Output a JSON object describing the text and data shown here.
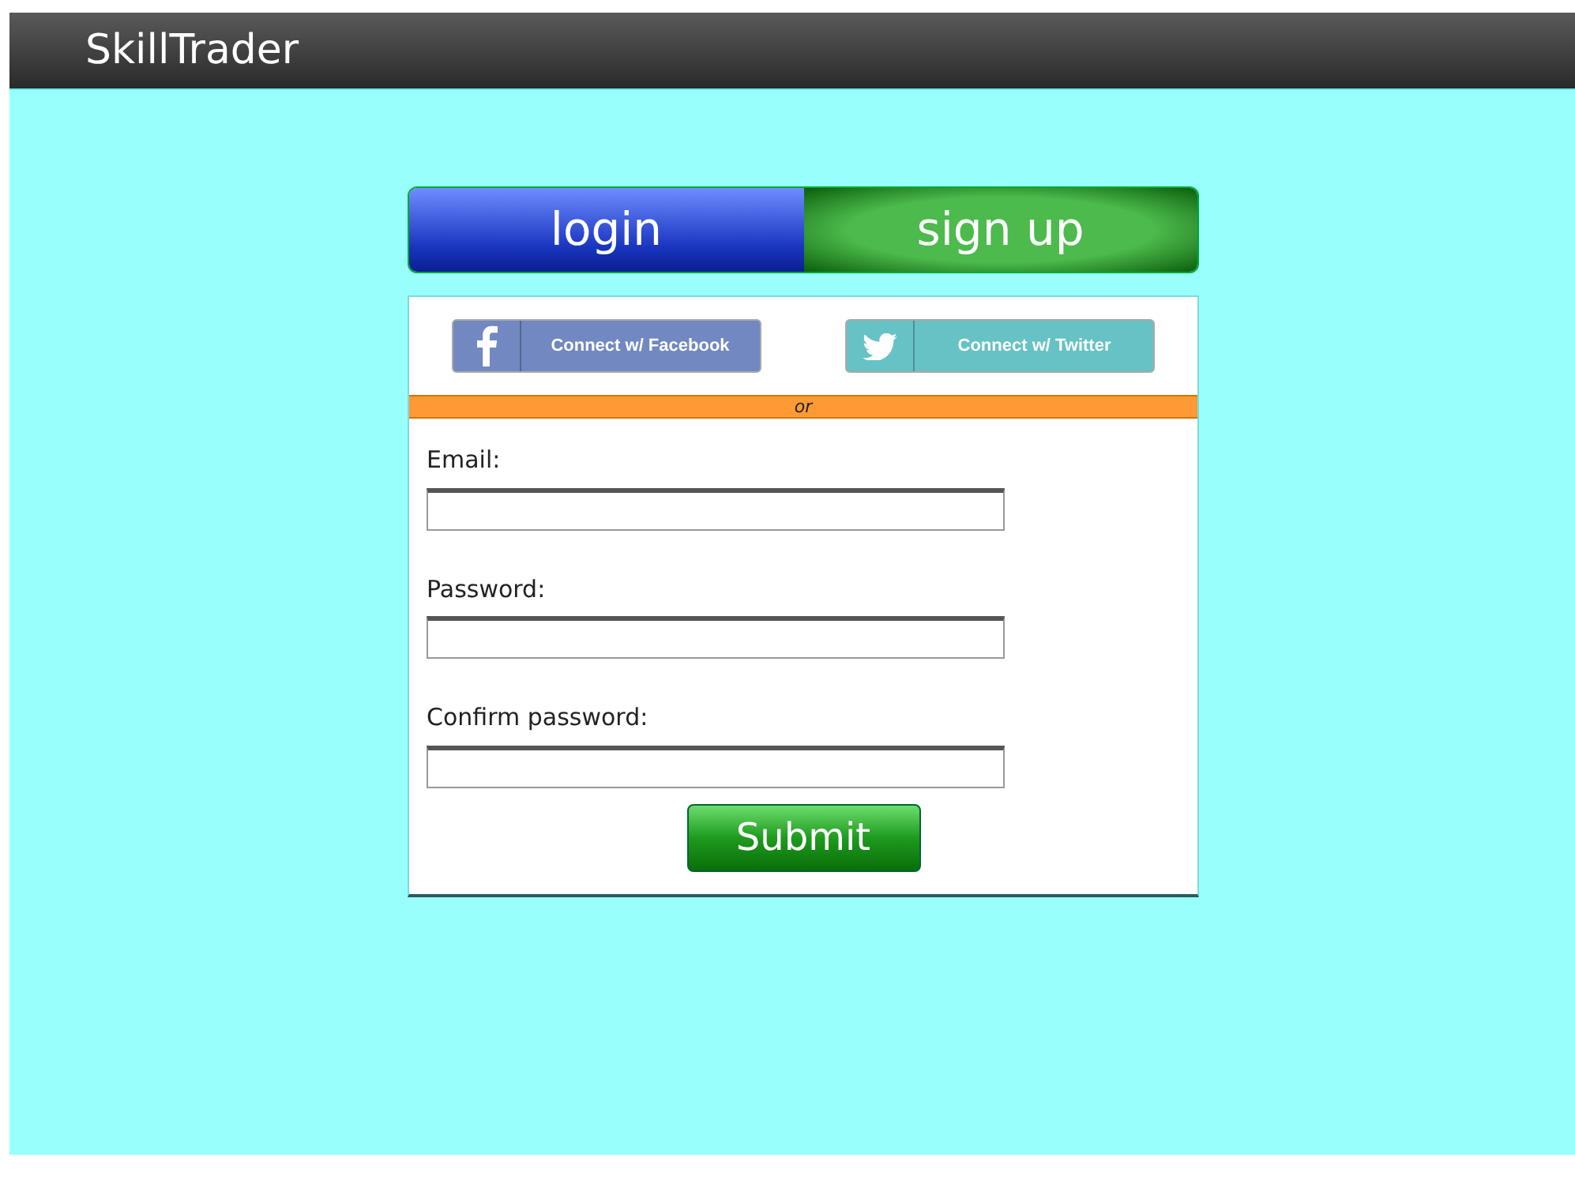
{
  "header": {
    "title": "SkillTrader"
  },
  "tabs": [
    {
      "label": "login",
      "selected": false
    },
    {
      "label": "sign up",
      "selected": true
    }
  ],
  "social_buttons": [
    {
      "kind": "facebook",
      "label": "Connect w/ Facebook"
    },
    {
      "kind": "twitter",
      "label": "Connect w/ Twitter"
    }
  ],
  "separator": "or",
  "fields": [
    {
      "label": "Email:"
    },
    {
      "label": "Password:"
    },
    {
      "label": "Confirm password:"
    }
  ],
  "submit": "Submit"
}
